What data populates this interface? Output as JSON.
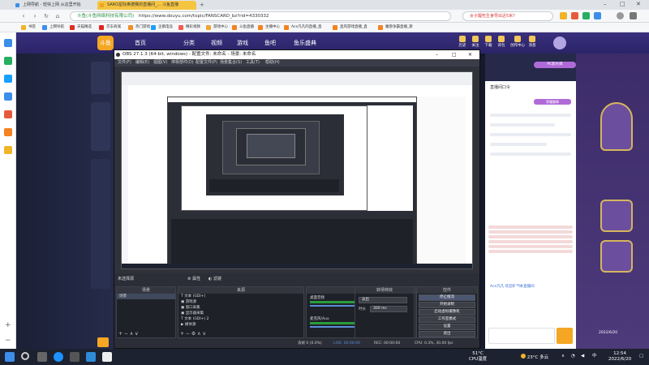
{
  "browser": {
    "tabs": [
      {
        "label": "上网导航 - 轻快上网 从这里开始",
        "color": "#3b8eea"
      },
      {
        "label": "SARO星际奥德赛的直播间_... 斗鱼直播",
        "color": "#f3a221"
      }
    ],
    "url": "https://www.douyu.com/topic/FANSCARD_bz?rid=4330332",
    "url_secure_label": "斗鱼(斗鱼网络科技有限公司)",
    "search_hint": "女子醒吃生食导出近5米?",
    "bookmarks": [
      {
        "label": "书签",
        "color": "#f0b429"
      },
      {
        "label": "上网导航",
        "color": "#3b8eea"
      },
      {
        "label": "天猫精选",
        "color": "#e02e24"
      },
      {
        "label": "京东商城",
        "color": "#e1251b"
      },
      {
        "label": "热门游戏",
        "color": "#f28c28"
      },
      {
        "label": "企鹅电竞",
        "color": "#19a0ff"
      },
      {
        "label": "精彩视频",
        "color": "#f25c54"
      },
      {
        "label": "游戏中心",
        "color": "#f2a531"
      },
      {
        "label": "斗鱼直播",
        "color": "#f58220"
      },
      {
        "label": "主播中心",
        "color": "#f58220"
      },
      {
        "label": "Ace凡凡的直播_直",
        "color": "#f58220"
      },
      {
        "label": "直风游戏直播_直",
        "color": "#f58220"
      },
      {
        "label": "魔兽争霸直播_斯",
        "color": "#f58220"
      }
    ]
  },
  "douyu": {
    "logo": "斗鱼",
    "nav": [
      "首页",
      "分类",
      "视频",
      "游戏",
      "鱼吧",
      "鱼乐盛典"
    ],
    "header_icons": [
      "历史",
      "关注",
      "下载",
      "背包",
      "创作中心",
      "消息"
    ],
    "chat_title": "直播间口令",
    "rank_label": "荣耀徽章",
    "chat_tip": "Ace凡凡 欢迎来到本直播间",
    "pc_badge": "PC影片库",
    "date_stamp": "2022/6/20"
  },
  "obs": {
    "title": "OBS 27.1.3 (64-bit, windows) - 配置文件: 未命名 - 场景: 未命名",
    "menu": [
      "文件(F)",
      "编辑(E)",
      "视图(V)",
      "停靠部件(D)",
      "配置文件(P)",
      "场景集合(S)",
      "工具(T)",
      "帮助(H)"
    ],
    "scene_status": "未选择源",
    "scene_props": "属性",
    "scene_filters": "滤镜",
    "docks": {
      "scenes": {
        "title": "场景",
        "items": [
          "场景"
        ]
      },
      "sources": {
        "title": "来源",
        "items": [
          "文本 (GDI+)",
          "游戏源",
          "窗口采集",
          "显示器采集",
          "文本 (GDI+) 2",
          "媒体源",
          "窗口采集 2"
        ]
      },
      "mixer": {
        "title": "混音器",
        "tracks": [
          {
            "name": "桌面音频",
            "db": "0.0 dB"
          },
          {
            "name": "麦克风/Aux",
            "db": "0.0 dB"
          }
        ]
      },
      "transitions": {
        "title": "转场特效",
        "type": "淡出",
        "duration_label": "时长",
        "duration": "300 ms"
      },
      "controls": {
        "title": "控件",
        "buttons": [
          "停止推流",
          "开始录制",
          "启动虚拟摄像机",
          "工作室模式",
          "设置",
          "退出"
        ]
      }
    },
    "status": {
      "live": "LIVE: 00:00:00",
      "rec": "REC: 00:00:00",
      "cpu": "CPU: 0.3%, 30.00 fps",
      "dropped": "丢帧 0 (0.0%)"
    }
  },
  "taskbar": {
    "weather_temp": "23°C",
    "weather_desc": "多云",
    "cpu_temp": "51°C",
    "cpu_label": "CPU温度",
    "time": "12:54",
    "date": "2022/6/20",
    "ime": "中"
  }
}
